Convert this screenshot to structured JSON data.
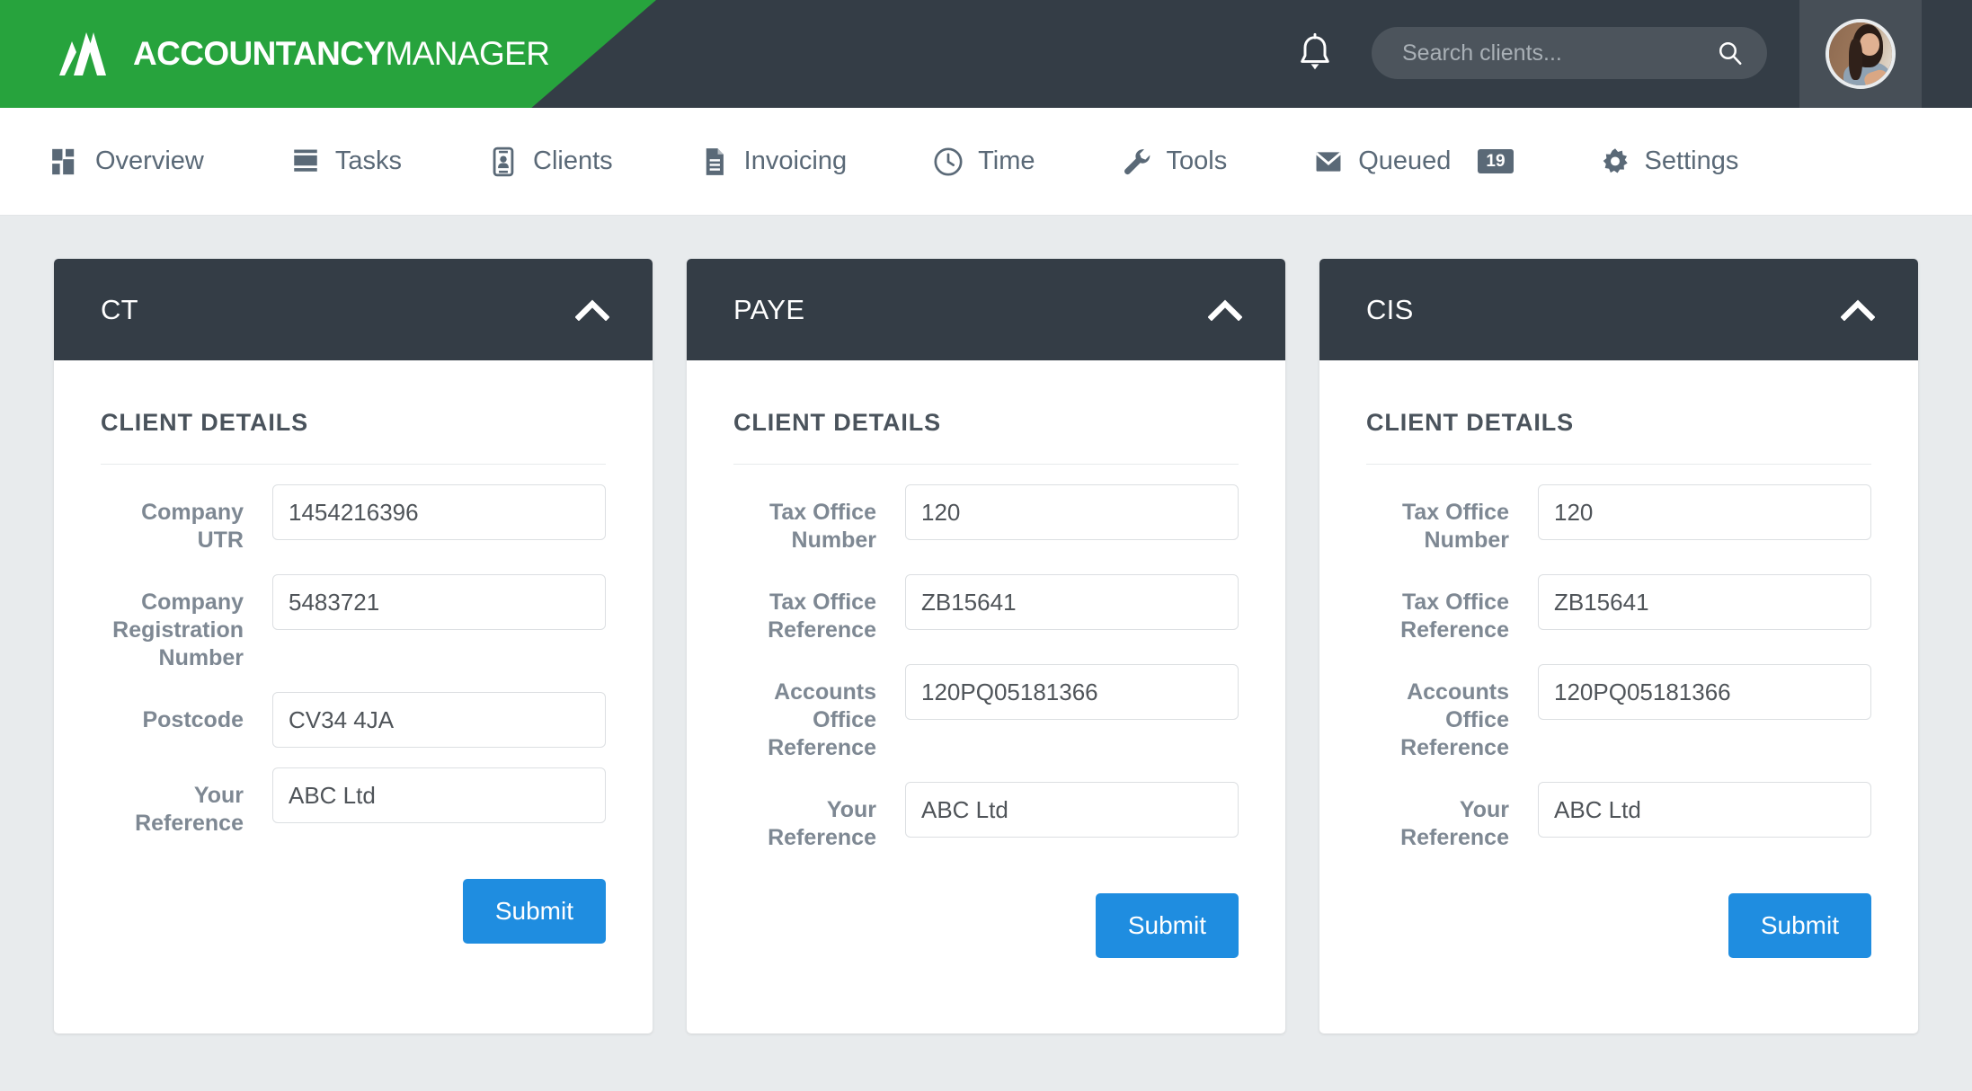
{
  "brand": {
    "name_bold": "ACCOUNTANCY",
    "name_light": "MANAGER",
    "logo_icon": "am-logo-icon"
  },
  "header": {
    "notifications_icon": "bell-icon",
    "search": {
      "placeholder": "Search clients...",
      "value": "",
      "icon": "search-icon"
    },
    "avatar_alt": "user-avatar"
  },
  "nav": {
    "items": [
      {
        "label": "Overview",
        "icon": "dashboard-grid-icon",
        "badge": ""
      },
      {
        "label": "Tasks",
        "icon": "list-lines-icon",
        "badge": ""
      },
      {
        "label": "Clients",
        "icon": "contact-card-icon",
        "badge": ""
      },
      {
        "label": "Invoicing",
        "icon": "document-icon",
        "badge": ""
      },
      {
        "label": "Time",
        "icon": "clock-icon",
        "badge": ""
      },
      {
        "label": "Tools",
        "icon": "wrench-icon",
        "badge": ""
      },
      {
        "label": "Queued",
        "icon": "envelope-icon",
        "badge": "19"
      },
      {
        "label": "Settings",
        "icon": "gear-icon",
        "badge": ""
      }
    ]
  },
  "colors": {
    "brand_green": "#27a33d",
    "dark_slate": "#343d46",
    "accent_blue": "#1f8de0",
    "page_background": "#e8ebed",
    "label_gray": "#7e8893"
  },
  "cards": [
    {
      "title": "CT",
      "collapse_icon": "chevron-up-icon",
      "section_title": "CLIENT DETAILS",
      "fields": [
        {
          "label": "Company UTR",
          "value": "1454216396"
        },
        {
          "label": "Company Registration Number",
          "value": "5483721"
        },
        {
          "label": "Postcode",
          "value": "CV34 4JA"
        },
        {
          "label": "Your Reference",
          "value": "ABC Ltd"
        }
      ],
      "submit_label": "Submit"
    },
    {
      "title": "PAYE",
      "collapse_icon": "chevron-up-icon",
      "section_title": "CLIENT DETAILS",
      "fields": [
        {
          "label": "Tax Office Number",
          "value": "120"
        },
        {
          "label": "Tax Office Reference",
          "value": "ZB15641"
        },
        {
          "label": "Accounts Office Reference",
          "value": "120PQ05181366"
        },
        {
          "label": "Your Reference",
          "value": "ABC Ltd"
        }
      ],
      "submit_label": "Submit"
    },
    {
      "title": "CIS",
      "collapse_icon": "chevron-up-icon",
      "section_title": "CLIENT DETAILS",
      "fields": [
        {
          "label": "Tax Office Number",
          "value": "120"
        },
        {
          "label": "Tax Office Reference",
          "value": "ZB15641"
        },
        {
          "label": "Accounts Office Reference",
          "value": "120PQ05181366"
        },
        {
          "label": "Your Reference",
          "value": "ABC Ltd"
        }
      ],
      "submit_label": "Submit"
    }
  ]
}
